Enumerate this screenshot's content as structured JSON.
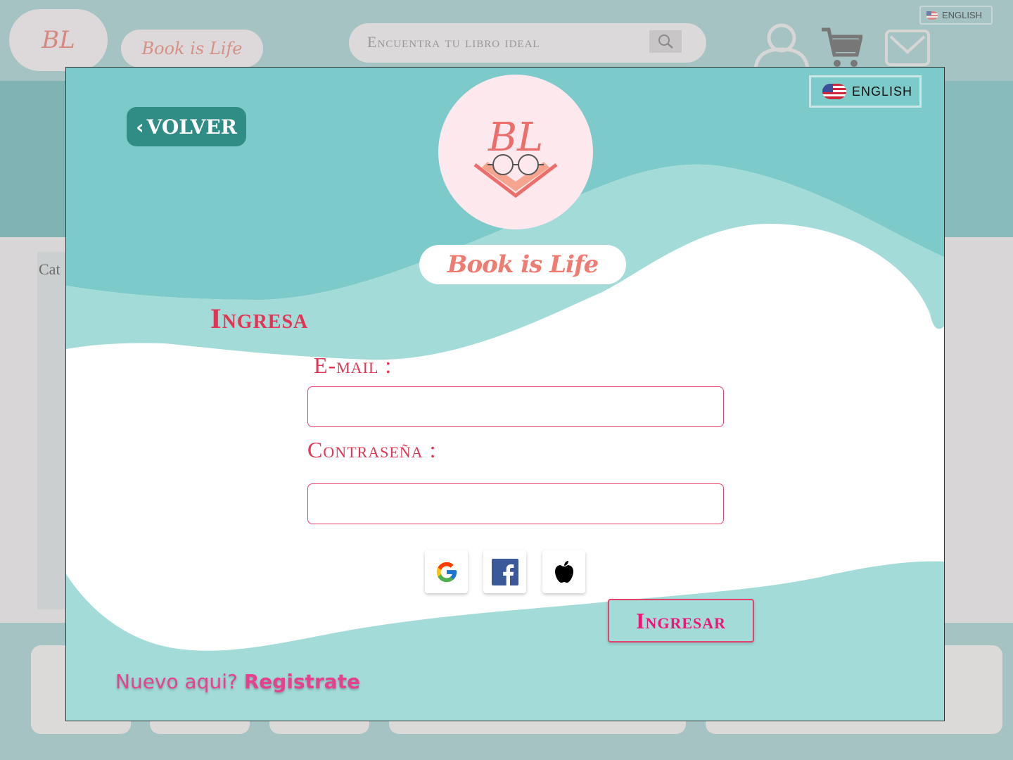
{
  "header": {
    "logo_initials": "BL",
    "brand_name": "Book is Life",
    "search_placeholder": "Encuentra tu libro ideal",
    "language_label": "ENGLISH"
  },
  "sidebar": {
    "title": "Cat"
  },
  "modal": {
    "language_label": "ENGLISH",
    "back_label": "VOLVER",
    "logo_initials": "BL",
    "brand_name": "Book is Life",
    "heading": "Ingresa",
    "email_label": "E-mail :",
    "email_value": "",
    "password_label": "Contraseña :",
    "password_value": "",
    "social_icons": [
      "google-icon",
      "facebook-icon",
      "apple-icon"
    ],
    "submit_label": "Ingresar",
    "register_prompt": "Nuevo aqui?",
    "register_link": "Registrate"
  },
  "colors": {
    "teal": "#7ccaca",
    "light_teal": "#a3dbd9",
    "back_button": "#2f8d86",
    "accent_red": "#e23553",
    "accent_pink": "#ee1577",
    "brand_coral": "#ef7c72"
  }
}
